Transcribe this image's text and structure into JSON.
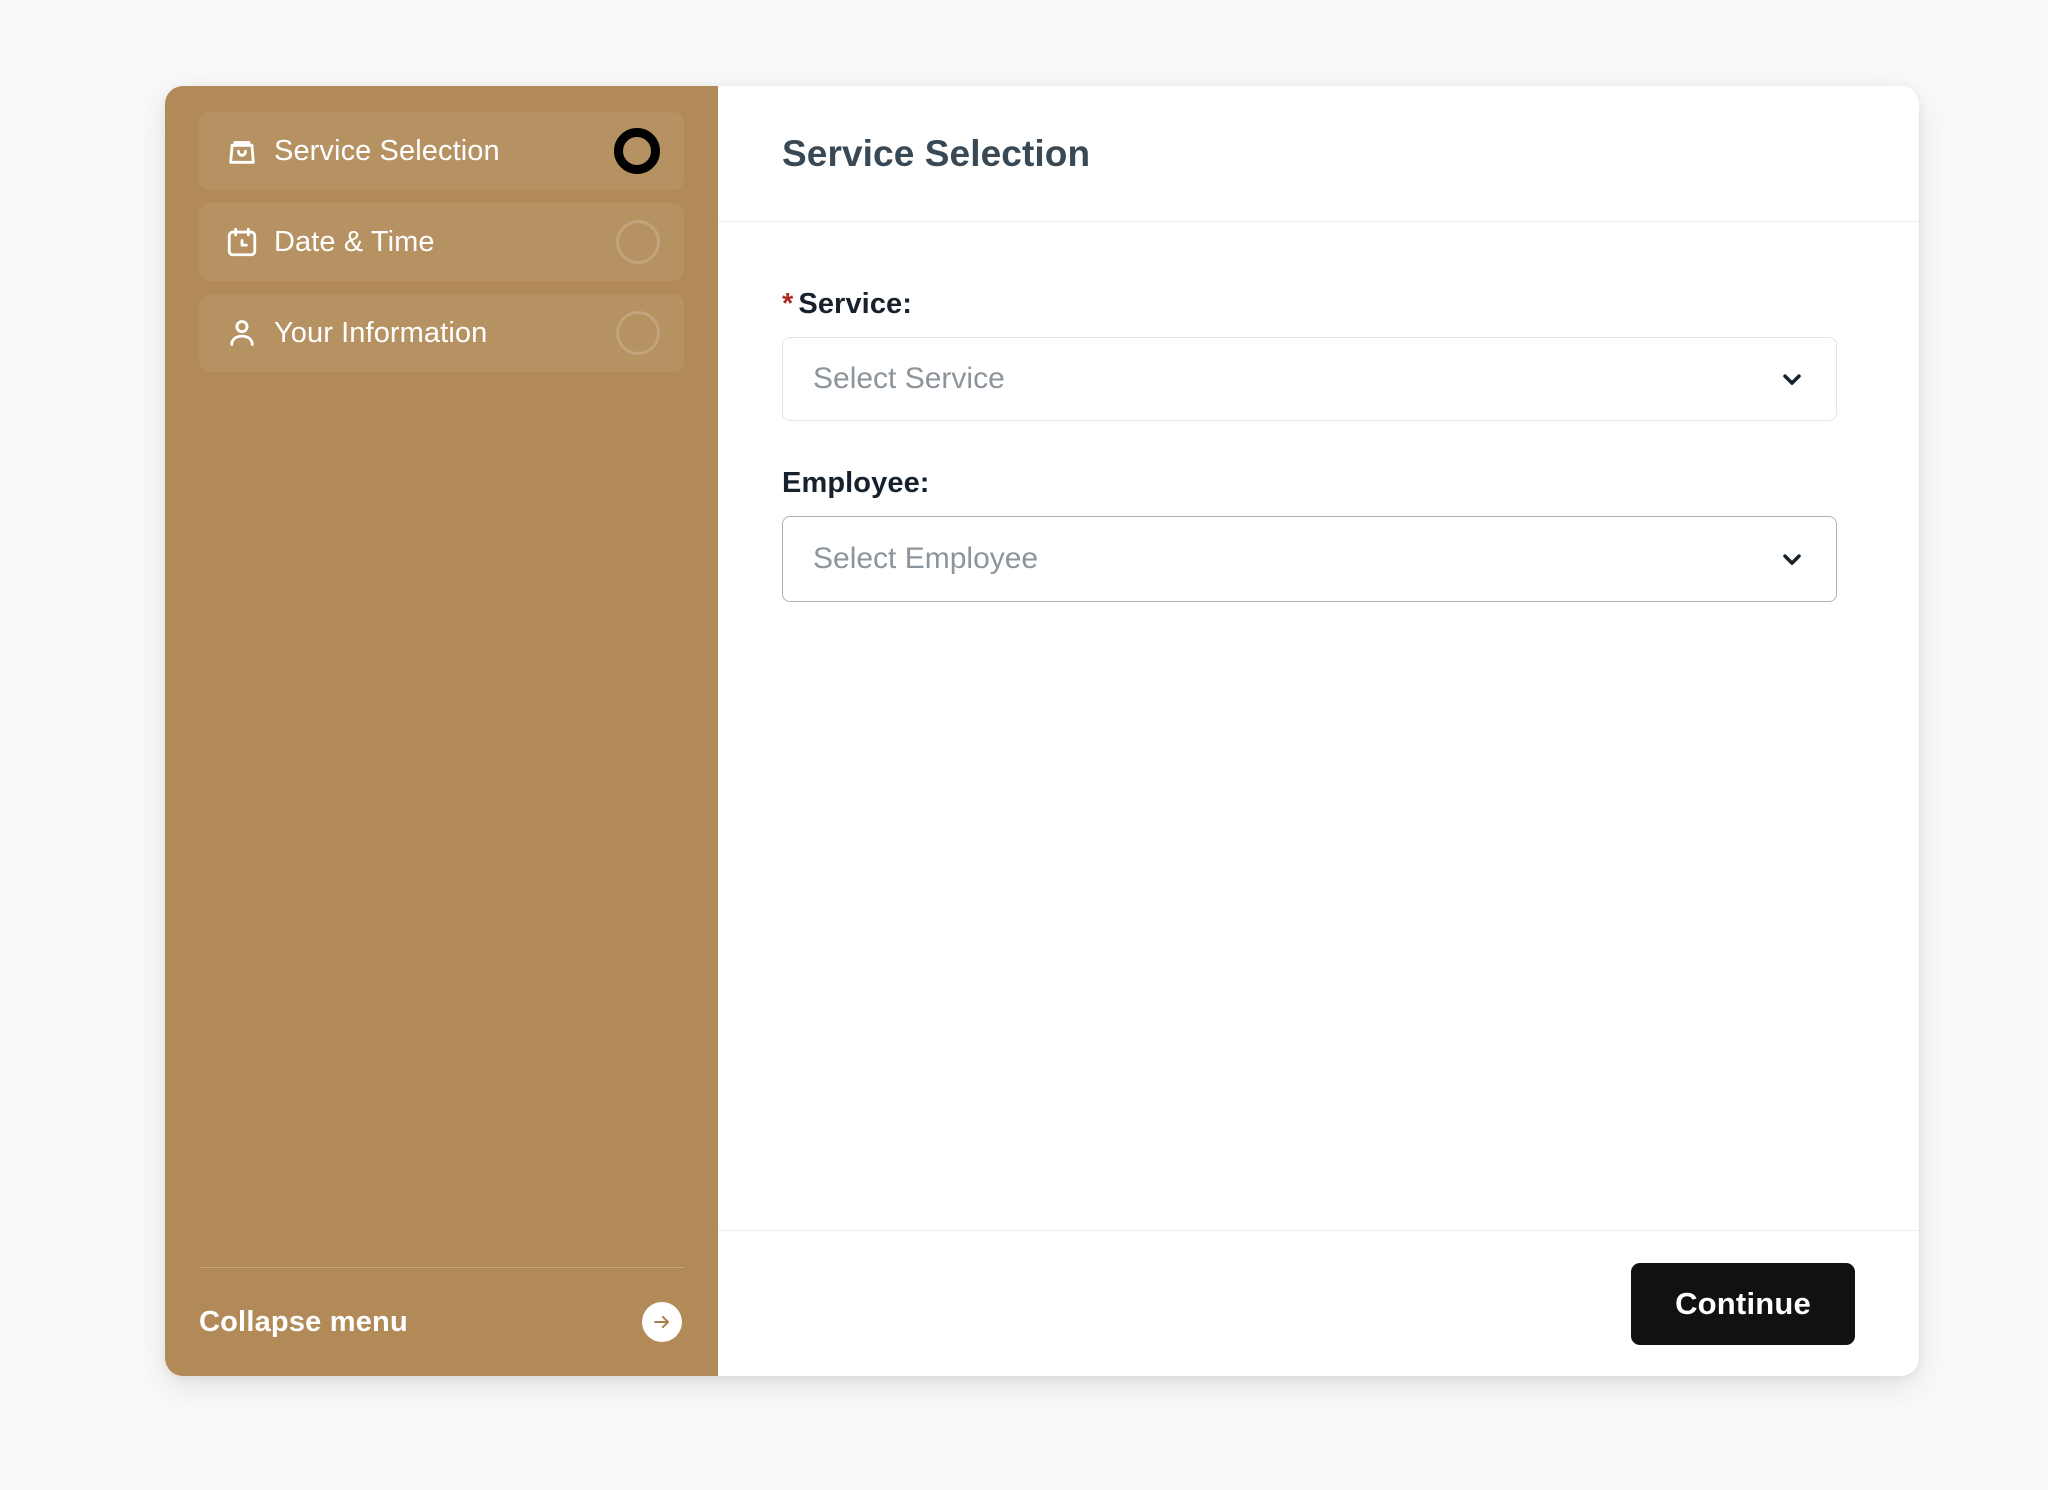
{
  "colors": {
    "sidebar_bg": "#b18a57",
    "page_bg": "#fafafa",
    "accent_black": "#111111",
    "required_red": "#b02a23",
    "title_text": "#384854",
    "placeholder_text": "#8d959c"
  },
  "sidebar": {
    "steps": [
      {
        "label": "Service Selection",
        "icon": "shopping-bag-icon",
        "state": "active"
      },
      {
        "label": "Date & Time",
        "icon": "calendar-clock-icon",
        "state": "inactive"
      },
      {
        "label": "Your Information",
        "icon": "person-icon",
        "state": "inactive"
      }
    ],
    "collapse": {
      "label": "Collapse menu",
      "icon": "arrow-right-icon"
    }
  },
  "main": {
    "header": {
      "title": "Service Selection"
    },
    "fields": [
      {
        "label": "Service:",
        "required": true,
        "required_marker": "*",
        "placeholder": "Select Service",
        "value": "",
        "icon": "chevron-down-icon",
        "focused": false
      },
      {
        "label": "Employee:",
        "required": false,
        "required_marker": "",
        "placeholder": "Select Employee",
        "value": "",
        "icon": "chevron-down-icon",
        "focused": true
      }
    ],
    "footer": {
      "continue_label": "Continue"
    }
  }
}
